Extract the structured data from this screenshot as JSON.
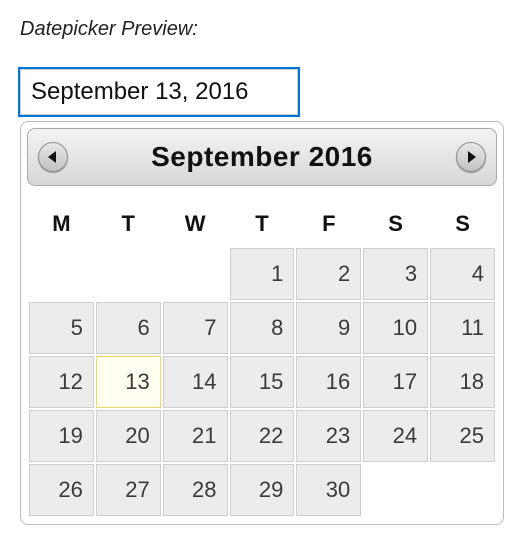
{
  "preview_label": "Datepicker Preview:",
  "date_input": {
    "value": "September 13, 2016",
    "placeholder": ""
  },
  "calendar": {
    "title": "September 2016",
    "prev_icon": "caret-left",
    "next_icon": "caret-right",
    "weekdays": [
      "M",
      "T",
      "W",
      "T",
      "F",
      "S",
      "S"
    ],
    "weeks": [
      [
        null,
        null,
        null,
        1,
        2,
        3,
        4
      ],
      [
        5,
        6,
        7,
        8,
        9,
        10,
        11
      ],
      [
        12,
        13,
        14,
        15,
        16,
        17,
        18
      ],
      [
        19,
        20,
        21,
        22,
        23,
        24,
        25
      ],
      [
        26,
        27,
        28,
        29,
        30,
        null,
        null
      ]
    ],
    "selected_day": 13
  },
  "colors": {
    "focus_outline": "#0076d6",
    "cell_bg": "#ececec",
    "cell_border": "#cfcfcf",
    "selected_bg": "#fffef0",
    "selected_border": "#e9d96a"
  },
  "chart_data": {
    "type": "table",
    "title": "September 2016",
    "columns": [
      "M",
      "T",
      "W",
      "T",
      "F",
      "S",
      "S"
    ],
    "rows": [
      [
        "",
        "",
        "",
        1,
        2,
        3,
        4
      ],
      [
        5,
        6,
        7,
        8,
        9,
        10,
        11
      ],
      [
        12,
        13,
        14,
        15,
        16,
        17,
        18
      ],
      [
        19,
        20,
        21,
        22,
        23,
        24,
        25
      ],
      [
        26,
        27,
        28,
        29,
        30,
        "",
        ""
      ]
    ]
  }
}
